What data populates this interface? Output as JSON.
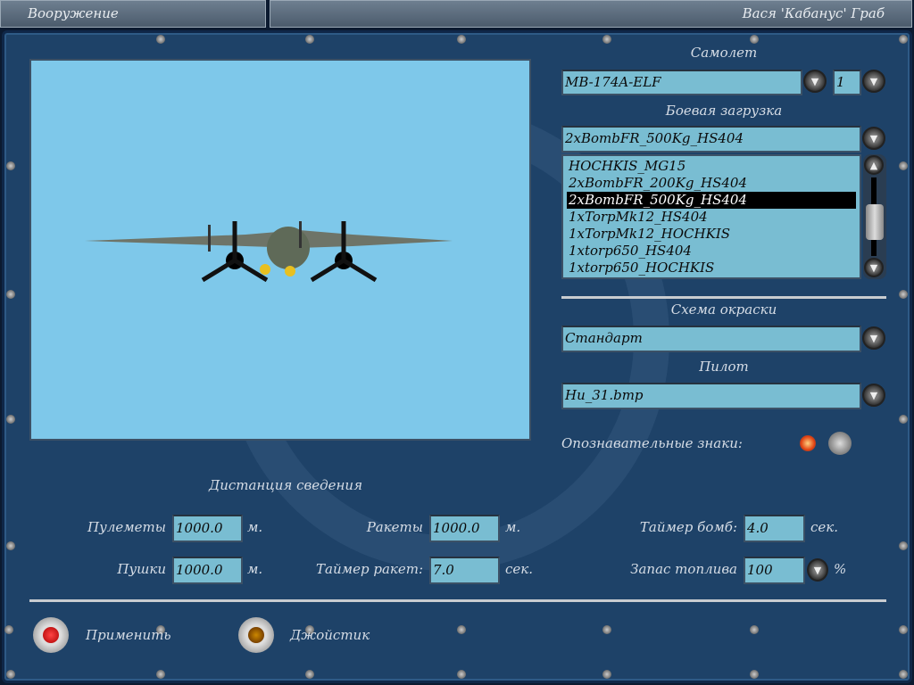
{
  "titlebar": {
    "screen_title": "Вооружение",
    "player_name": "Вася 'Кабанус' Граб"
  },
  "aircraft": {
    "label": "Самолет",
    "value": "MB-174A-ELF",
    "count": "1"
  },
  "loadout": {
    "label": "Боевая загрузка",
    "value": "2xBombFR_500Kg_HS404",
    "options": [
      "HOCHKIS_MG15",
      "2xBombFR_200Kg_HS404",
      "2xBombFR_500Kg_HS404",
      "1xTorpMk12_HS404",
      "1xTorpMk12_HOCHKIS",
      "1xtorp650_HS404",
      "1xtorp650_HOCHKIS"
    ],
    "selected_index": 2
  },
  "skin": {
    "label": "Схема окраски",
    "value": "Стандарт"
  },
  "pilot": {
    "label": "Пилот",
    "value": "Hu_31.bmp"
  },
  "markings": {
    "label": "Опознавательные знаки:",
    "on": true
  },
  "convergence": {
    "title": "Дистанция сведения",
    "mg_label": "Пулеметы",
    "mg_value": "1000.0",
    "mg_unit": "м.",
    "cannon_label": "Пушки",
    "cannon_value": "1000.0",
    "cannon_unit": "м.",
    "rockets_label": "Ракеты",
    "rockets_value": "1000.0",
    "rockets_unit": "м.",
    "rocket_timer_label": "Таймер ракет:",
    "rocket_timer_value": "7.0",
    "rocket_timer_unit": "сек.",
    "bomb_timer_label": "Таймер бомб:",
    "bomb_timer_value": "4.0",
    "bomb_timer_unit": "сек.",
    "fuel_label": "Запас топлива",
    "fuel_value": "100",
    "fuel_unit": "%"
  },
  "actions": {
    "apply": "Применить",
    "joystick": "Джойстик"
  },
  "colors": {
    "panel": "#1e4268",
    "field": "#79bdd2",
    "preview": "#7ec8ea"
  }
}
